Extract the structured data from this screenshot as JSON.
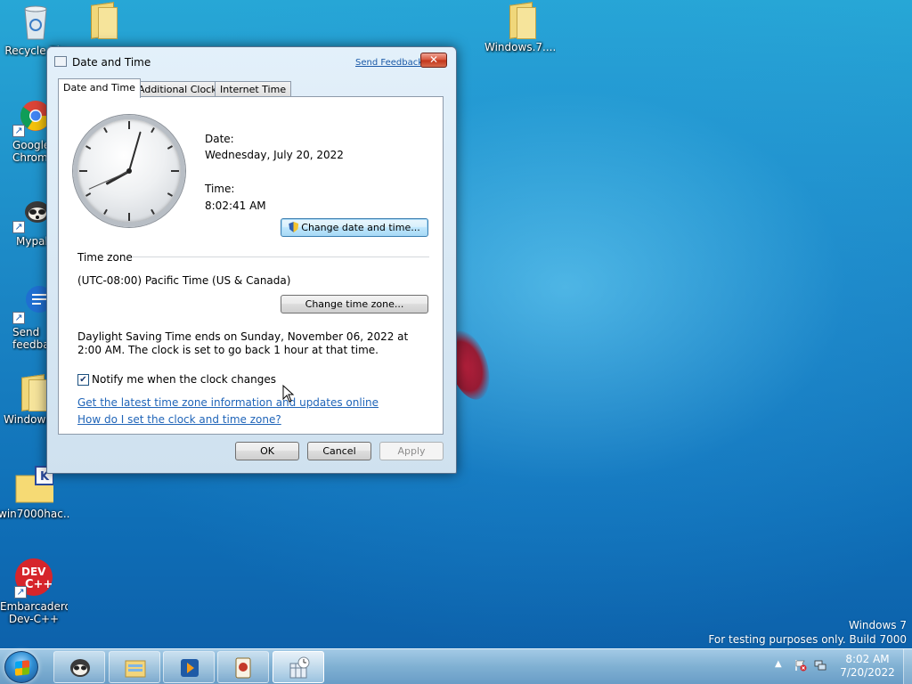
{
  "desktop": {
    "icons": [
      {
        "label": "Recycle Bin",
        "icon": "recycle-bin-icon"
      },
      {
        "label": "",
        "icon": "folder-icon"
      },
      {
        "label": "Windows.7....",
        "icon": "folder-icon"
      },
      {
        "label": "Google Chrome",
        "icon": "chrome-icon"
      },
      {
        "label": "Mypal",
        "icon": "mypal-icon"
      },
      {
        "label": "Send feedback",
        "icon": "feedback-icon"
      },
      {
        "label": "Windows",
        "icon": "folder-icon"
      },
      {
        "label": "win7000hac...",
        "icon": "archive-icon"
      },
      {
        "label": "Embarcadero Dev-C++",
        "icon": "devcpp-icon"
      }
    ]
  },
  "dialog": {
    "title": "Date and Time",
    "send_feedback": "Send Feedback",
    "close_label": "✕",
    "tabs": [
      {
        "label": "Date and Time",
        "active": true
      },
      {
        "label": "Additional Clocks",
        "active": false
      },
      {
        "label": "Internet Time",
        "active": false
      }
    ],
    "date_label": "Date:",
    "date_value": "Wednesday, July 20, 2022",
    "time_label": "Time:",
    "time_value": "8:02:41 AM",
    "change_date_button": "Change date and time...",
    "timezone_heading": "Time zone",
    "timezone_value": "(UTC-08:00) Pacific Time (US & Canada)",
    "change_timezone_button": "Change time zone...",
    "dst_text": "Daylight Saving Time ends on Sunday, November 06, 2022 at 2:00 AM. The clock is set to go back 1 hour at that time.",
    "notify_checkbox_label": "Notify me when the clock changes",
    "notify_checked": true,
    "link_latest_timezone": "Get the latest time zone information and updates online",
    "link_how_set_clock": "How do I set the clock and time zone?",
    "ok_button": "OK",
    "cancel_button": "Cancel",
    "apply_button": "Apply",
    "clock": {
      "hours": 8,
      "minutes": 2,
      "seconds": 41
    }
  },
  "taskbar": {
    "pinned": [
      {
        "name": "mypal-icon"
      },
      {
        "name": "explorer-icon"
      },
      {
        "name": "media-player-icon"
      },
      {
        "name": "solitaire-icon"
      },
      {
        "name": "date-time-icon",
        "active": true
      }
    ],
    "tray_time": "8:02 AM",
    "tray_date": "7/20/2022"
  },
  "watermark": {
    "line1": "Windows 7",
    "line2": "For testing purposes only. Build 7000"
  },
  "colors": {
    "link": "#1f64b8",
    "close_button": "#c23418",
    "desktop_bg": "#1a84c4"
  }
}
